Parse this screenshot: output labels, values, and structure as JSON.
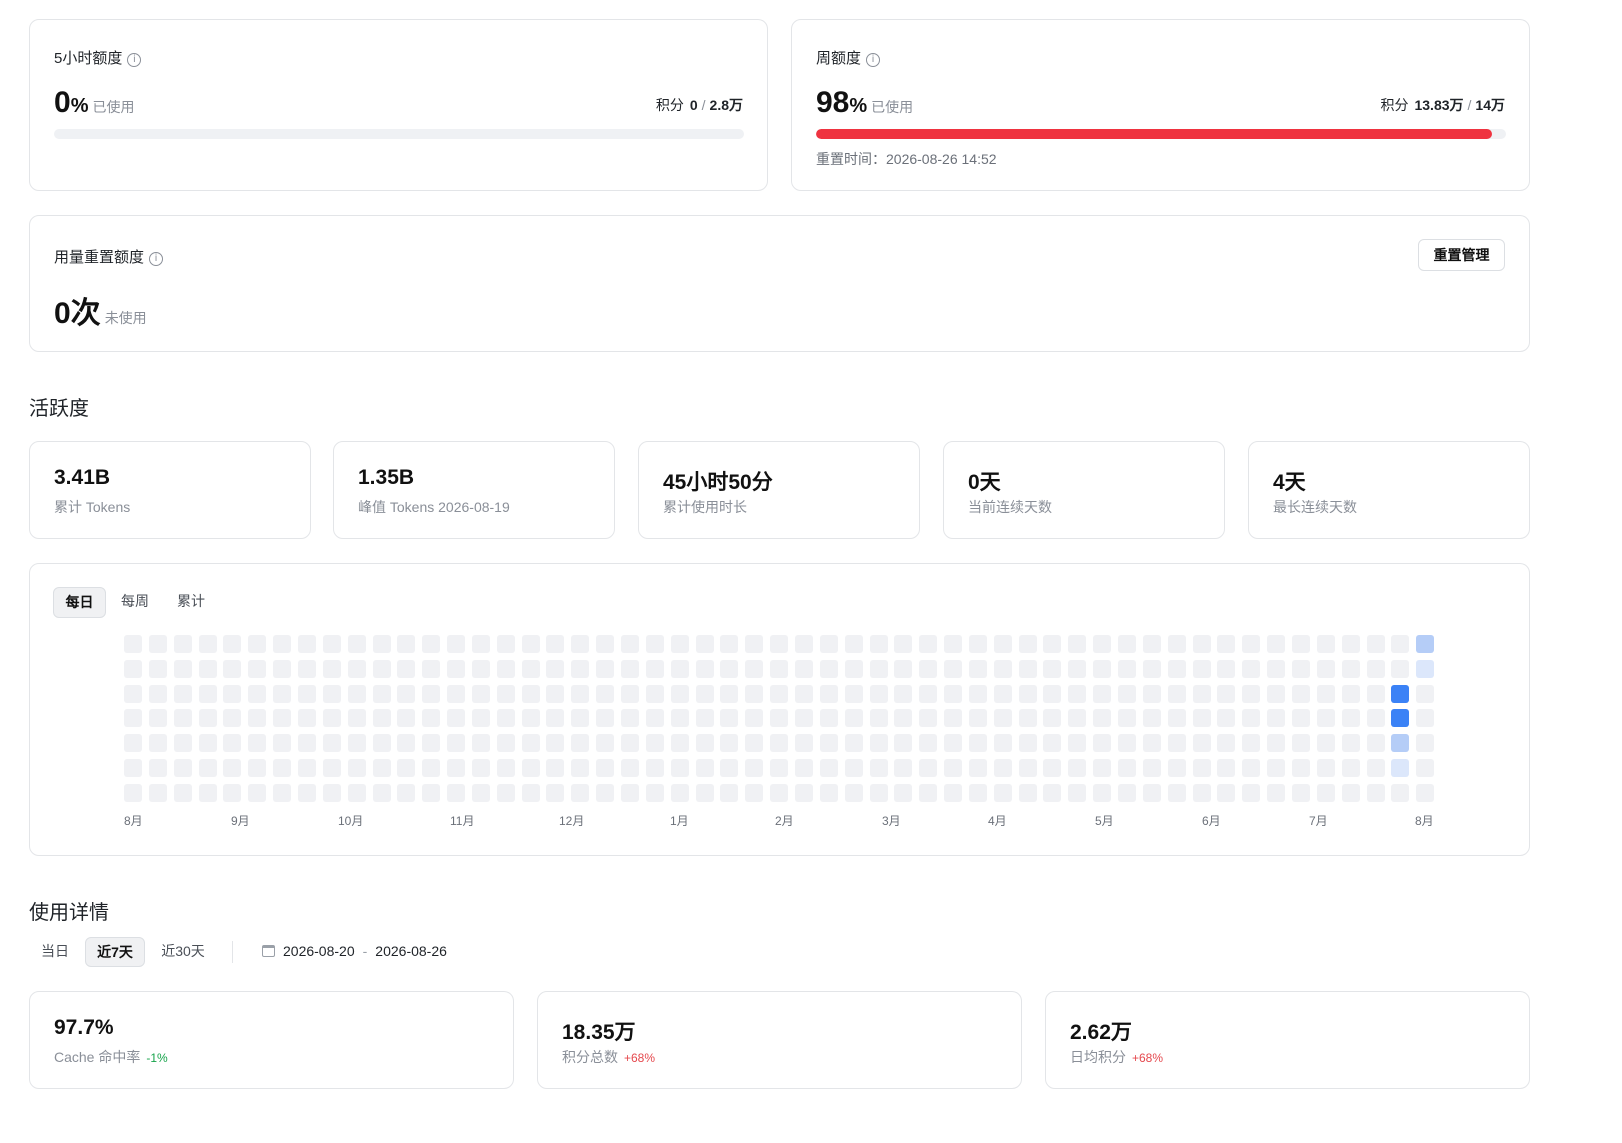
{
  "quota_5h": {
    "title": "5小时额度",
    "info_icon": "info-icon",
    "percent": "0",
    "percent_unit": "%",
    "used_label": "已使用",
    "points_label": "积分",
    "points_used": "0",
    "points_sep": "/",
    "points_total": "2.8万",
    "progress": 0.0,
    "bar_color": "#e5484d"
  },
  "quota_week": {
    "title": "周额度",
    "info_icon": "info-icon",
    "percent": "98",
    "percent_unit": "%",
    "used_label": "已使用",
    "points_label": "积分",
    "points_used": "13.83万",
    "points_sep": "/",
    "points_total": "14万",
    "progress": 0.98,
    "bar_color": "#ef3340",
    "reset_time": "重置时间：2026-08-26 14:52"
  },
  "usage_reset": {
    "title": "用量重置额度",
    "info_icon": "info-icon",
    "value": "0次",
    "status": "未使用",
    "manage_button": "重置管理"
  },
  "activity": {
    "section_title": "活跃度",
    "stats": [
      {
        "value": "3.41B",
        "label": "累计 Tokens"
      },
      {
        "value": "1.35B",
        "label": "峰值 Tokens 2026-08-19"
      },
      {
        "value": "45小时50分",
        "label": "累计使用时长"
      },
      {
        "value": "0天",
        "label": "当前连续天数"
      },
      {
        "value": "4天",
        "label": "最长连续天数"
      }
    ],
    "tabs": [
      "每日",
      "每周",
      "累计"
    ],
    "active_tab": 0,
    "heatmap": {
      "weeks": 53,
      "days": 7,
      "months": [
        "8月",
        "9月",
        "10月",
        "11月",
        "12月",
        "1月",
        "2月",
        "3月",
        "4月",
        "5月",
        "6月",
        "7月",
        "8月"
      ],
      "colors": {
        "0": "#f0f1f4",
        "1": "#dce7fb",
        "2": "#b5cdf7",
        "3": "#3b82f6"
      },
      "active_cells": [
        {
          "week": 51,
          "day": 2,
          "level": 3
        },
        {
          "week": 51,
          "day": 3,
          "level": 3
        },
        {
          "week": 51,
          "day": 4,
          "level": 2
        },
        {
          "week": 51,
          "day": 5,
          "level": 1
        },
        {
          "week": 52,
          "day": 0,
          "level": 2
        },
        {
          "week": 52,
          "day": 1,
          "level": 1
        }
      ]
    }
  },
  "usage_details": {
    "section_title": "使用详情",
    "ranges": [
      "当日",
      "近7天",
      "近30天"
    ],
    "active_range": 1,
    "calendar_icon": "calendar-icon",
    "date_from": "2026-08-20",
    "date_sep": "-",
    "date_to": "2026-08-26",
    "metrics": [
      {
        "value": "97.7%",
        "label": "Cache 命中率",
        "delta": "-1%",
        "delta_color": "#16a34a"
      },
      {
        "value": "18.35万",
        "label": "积分总数",
        "delta": "+68%",
        "delta_color": "#e5484d"
      },
      {
        "value": "2.62万",
        "label": "日均积分",
        "delta": "+68%",
        "delta_color": "#e5484d"
      }
    ]
  }
}
